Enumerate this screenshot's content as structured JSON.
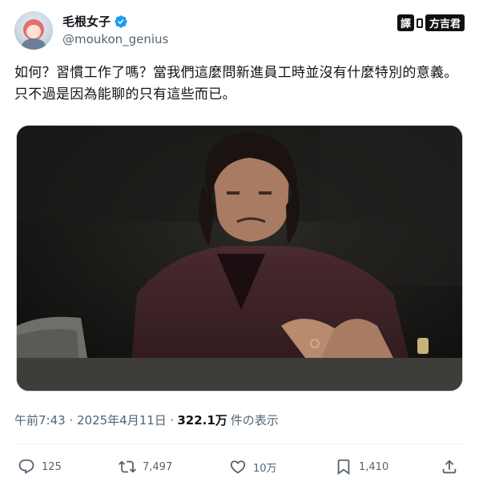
{
  "author": {
    "display_name": "毛根女子",
    "handle": "@moukon_genius",
    "verified_icon": "verified-badge-icon"
  },
  "watermark": {
    "left": "譯",
    "right": "方吉君"
  },
  "tweet": {
    "text": "如何？習慣工作了嗎？當我們這麼問新進員工時並沒有什麼特別的意義。只不過是因為能聊的只有這些而已。"
  },
  "meta": {
    "timestamp": "午前7:43 · 2025年4月11日 ·",
    "views_count": "322.1万",
    "views_label": "件の表示"
  },
  "actions": {
    "reply": {
      "icon": "reply-icon",
      "count": "125"
    },
    "retweet": {
      "icon": "retweet-icon",
      "count": "7,497"
    },
    "like": {
      "icon": "like-icon",
      "count": "10万"
    },
    "bookmark": {
      "icon": "bookmark-icon",
      "count": "1,410"
    },
    "share": {
      "icon": "share-icon"
    }
  },
  "colors": {
    "text_primary": "#0f1419",
    "text_secondary": "#536471",
    "verified_blue": "#1d9bf0",
    "divider": "#eff3f4"
  }
}
